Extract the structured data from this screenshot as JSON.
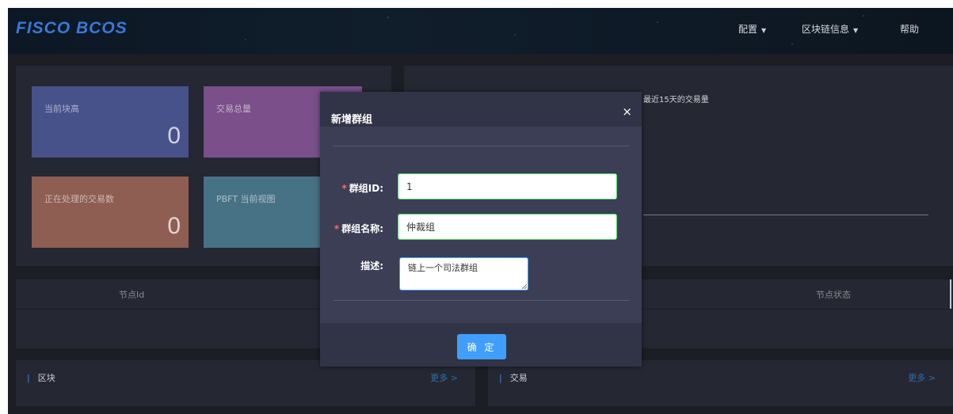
{
  "header": {
    "logo": "FISCO BCOS",
    "nav": [
      {
        "label": "配置",
        "has_dropdown": true
      },
      {
        "label": "区块链信息",
        "has_dropdown": true
      },
      {
        "label": "帮助",
        "has_dropdown": false
      }
    ]
  },
  "stats": {
    "block_height": {
      "label": "当前块高",
      "value": "0"
    },
    "tx_total": {
      "label": "交易总量"
    },
    "pending_tx": {
      "label": "正在处理的交易数",
      "value": "0"
    },
    "pbft_view": {
      "label": "PBFT 当前视图"
    }
  },
  "chart": {
    "title": "最近15天的交易量"
  },
  "node_table": {
    "columns": [
      "节点Id",
      "节点状态"
    ]
  },
  "sections": {
    "blocks": {
      "title": "区块",
      "more": "更多 >"
    },
    "transactions": {
      "title": "交易",
      "more": "更多 >"
    }
  },
  "modal": {
    "title": "新增群组",
    "close": "×",
    "fields": {
      "group_id": {
        "label": "群组ID:",
        "value": "1",
        "required": true
      },
      "group_name": {
        "label": "群组名称:",
        "value": "仲裁组",
        "required": true
      },
      "description": {
        "label": "描述:",
        "value": "链上一个司法群组",
        "required": false
      }
    },
    "confirm_label": "确 定"
  },
  "colors": {
    "primary": "#409eff",
    "valid_border": "#4cd964",
    "required_star": "#f56c6c",
    "card_block_height": "#47518a",
    "card_tx_total": "#7a4f8a",
    "card_pending": "#8e5e52",
    "card_pbft": "#477286"
  }
}
